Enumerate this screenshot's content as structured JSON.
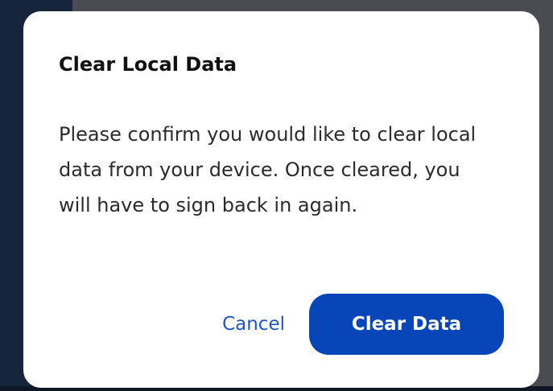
{
  "dialog": {
    "title": "Clear Local Data",
    "message": "Please confirm you would like to clear local data from your device. Once cleared, you will have to sign back in again.",
    "cancel_label": "Cancel",
    "confirm_label": "Clear Data"
  },
  "theme": {
    "primary": "#0845b8",
    "link": "#1f56c7",
    "backdrop": "#4a4c52",
    "sidebar": "#17253c"
  }
}
